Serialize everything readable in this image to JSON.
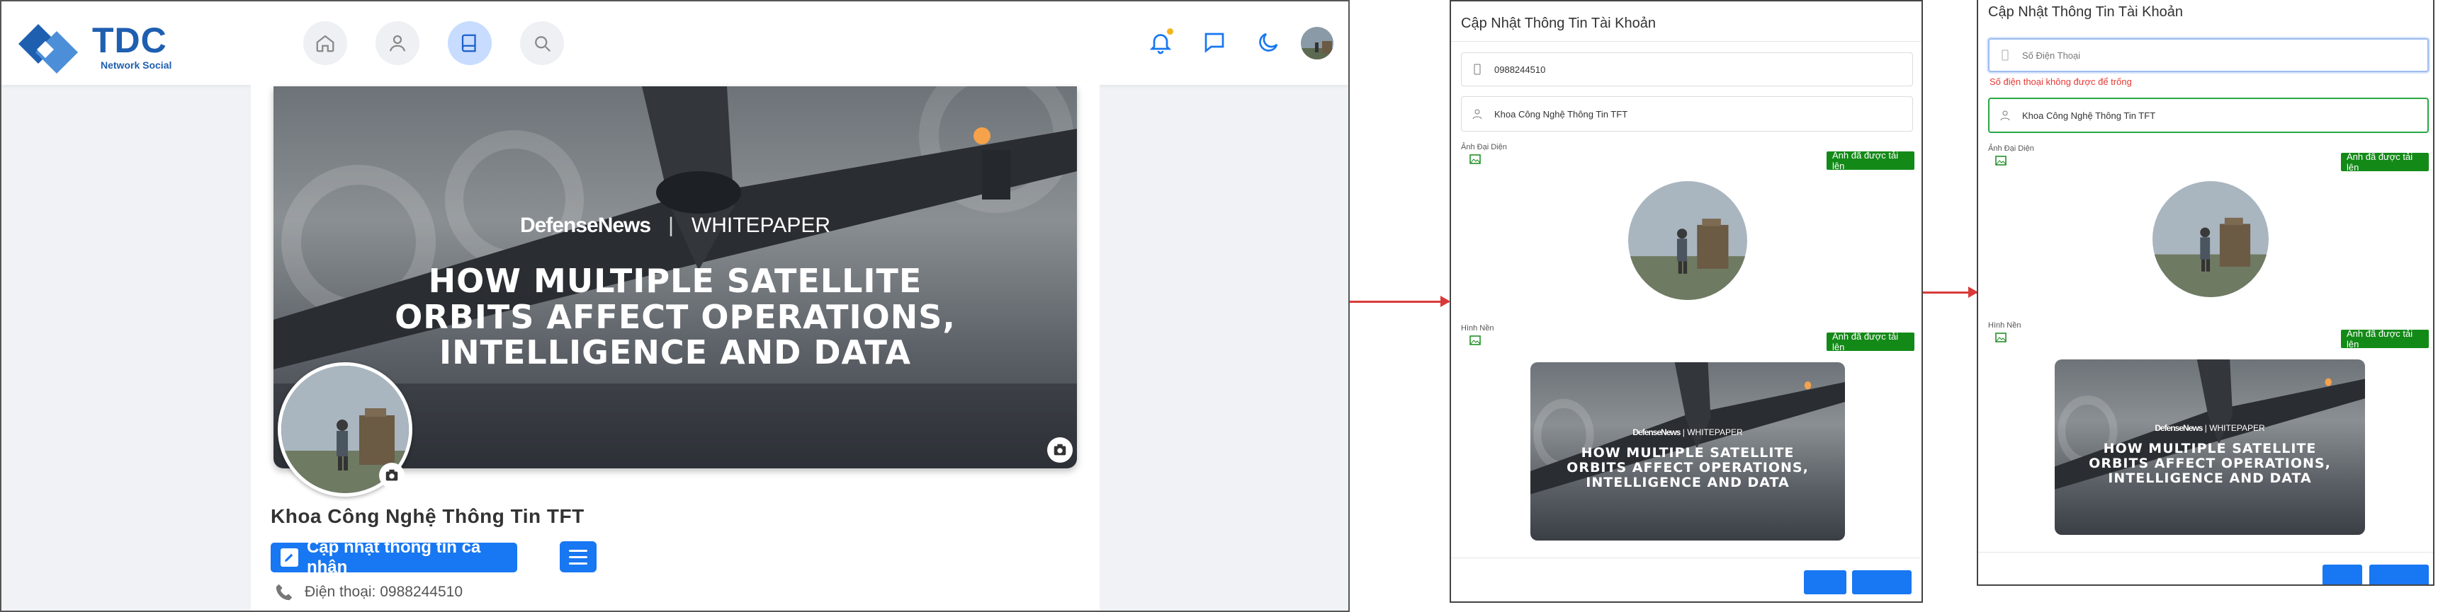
{
  "nav": {
    "logo_text": "TDC",
    "logo_sub": "Network Social",
    "items": [
      {
        "name": "home-icon",
        "active": false
      },
      {
        "name": "user-icon",
        "active": false
      },
      {
        "name": "book-icon",
        "active": true
      },
      {
        "name": "search-icon",
        "active": false
      }
    ],
    "right_icons": [
      "bell-icon",
      "chat-icon",
      "moon-icon"
    ]
  },
  "profile": {
    "name": "Khoa Công Nghệ Thông Tin TFT",
    "update_button": "Cập nhật thông tin cá nhân",
    "phone_line": "Điện thoại: 0988244510"
  },
  "cover_art": {
    "brand": "DefenseNews",
    "brand_sub": "WHITEPAPER",
    "headline": [
      "HOW MULTIPLE SATELLITE",
      "ORBITS AFFECT OPERATIONS,",
      "INTELLIGENCE AND DATA"
    ]
  },
  "modal1": {
    "title": "Cập Nhật Thông Tin Tài Khoản",
    "phone_value": "0988244510",
    "name_value": "Khoa Công Nghệ Thông Tin TFT",
    "avatar_label": "Ảnh Đại Diện",
    "cover_label": "Hình Nền",
    "uploaded_label": "Ảnh đã được tải lên"
  },
  "modal2": {
    "title": "Cập Nhật Thông Tin Tài Khoản",
    "phone_placeholder": "Số Điện Thoại",
    "phone_error": "Số điện thoại không được để trống",
    "name_value": "Khoa Công Nghệ Thông Tin TFT",
    "avatar_label": "Ảnh Đại Diện",
    "cover_label": "Hình Nền",
    "uploaded_label": "Ảnh đã được tải lên"
  },
  "colors": {
    "primary": "#1877f2",
    "success": "#138a18",
    "error": "#e53935",
    "logo": "#1f5fb0",
    "arrow": "#d83a3a"
  }
}
